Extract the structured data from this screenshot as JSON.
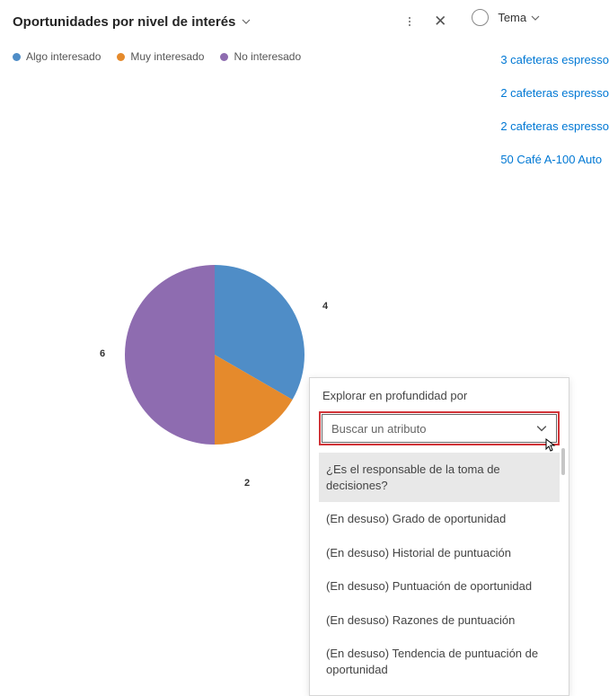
{
  "header": {
    "title": "Oportunidades por nivel de interés"
  },
  "legend": [
    {
      "label": "Algo interesado",
      "color": "#4f8dc7"
    },
    {
      "label": "Muy interesado",
      "color": "#e58a2c"
    },
    {
      "label": "No interesado",
      "color": "#8e6cb0"
    }
  ],
  "chart_data": {
    "type": "pie",
    "title": "Oportunidades por nivel de interés",
    "categories": [
      "Algo interesado",
      "Muy interesado",
      "No interesado"
    ],
    "values": [
      4,
      2,
      6
    ],
    "colors": [
      "#4f8dc7",
      "#e58a2c",
      "#8e6cb0"
    ]
  },
  "labels": {
    "val_4": "4",
    "val_2": "2",
    "val_6": "6"
  },
  "right": {
    "column_header": "Tema",
    "links": [
      "3 cafeteras espresso",
      "2 cafeteras espresso",
      "2 cafeteras espresso",
      "50 Café A-100 Auto"
    ]
  },
  "dropdown": {
    "label": "Explorar en profundidad por",
    "placeholder": "Buscar un atributo",
    "options": [
      "¿Es el responsable de la toma de decisiones?",
      "(En desuso) Grado de oportunidad",
      "(En desuso) Historial de puntuación",
      "(En desuso) Puntuación de oportunidad",
      "(En desuso) Razones de puntuación",
      "(En desuso) Tendencia de puntuación de oportunidad"
    ]
  }
}
